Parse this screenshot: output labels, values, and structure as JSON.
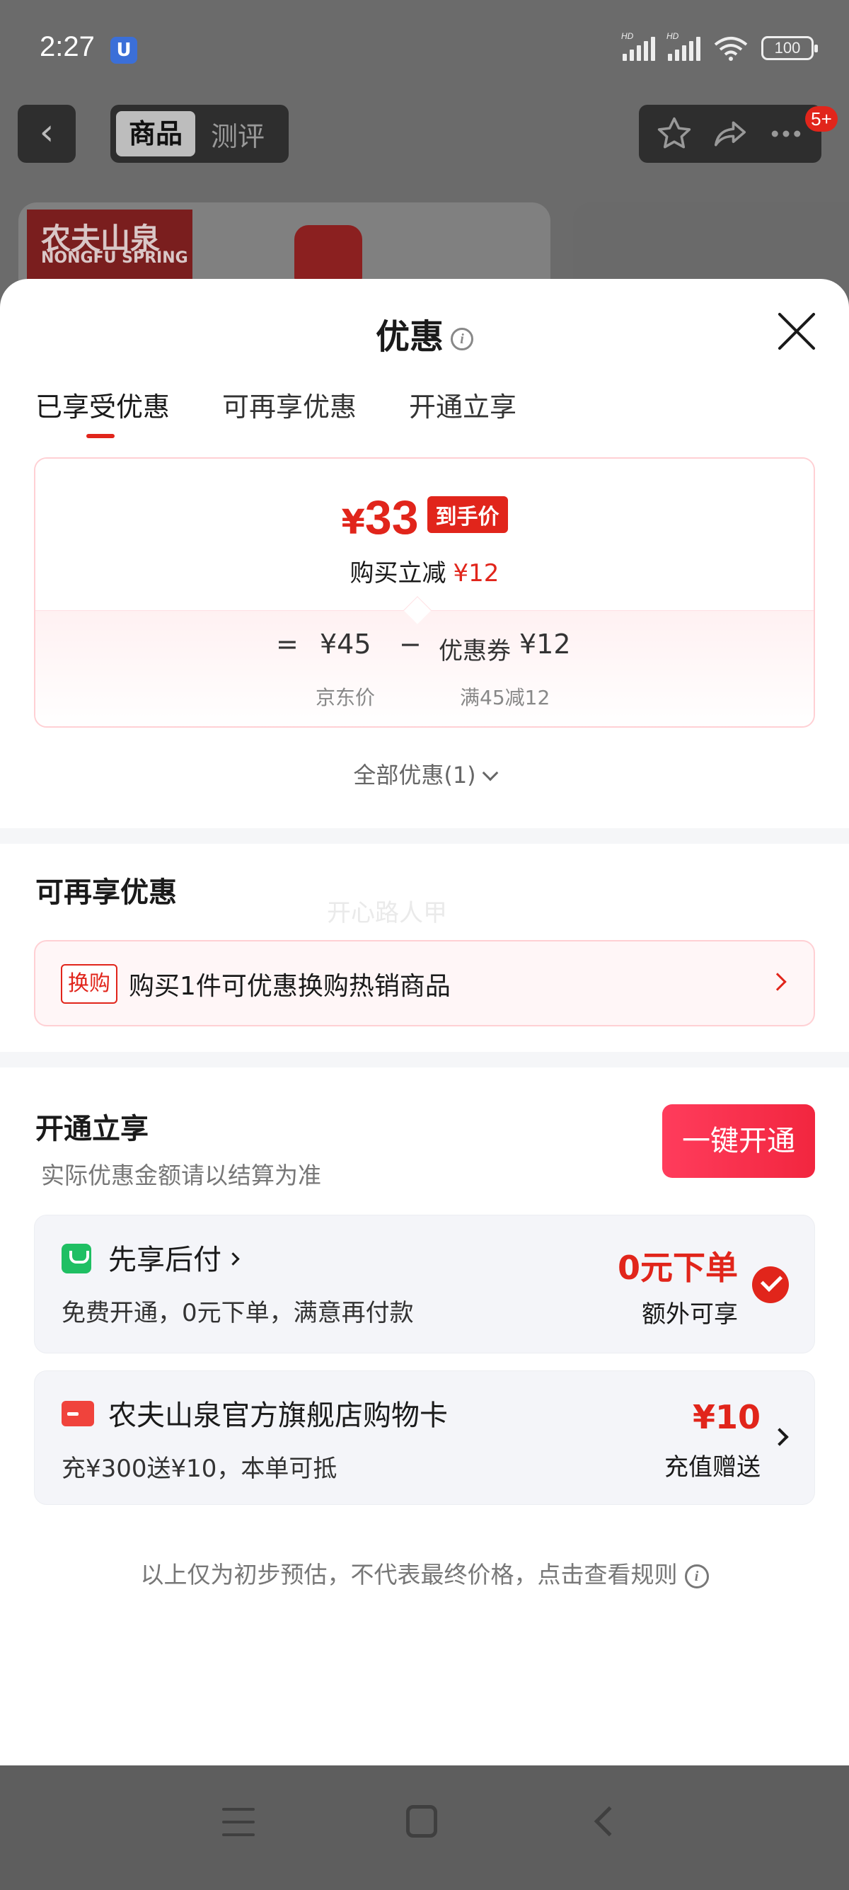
{
  "status_bar": {
    "time": "2:27",
    "app_icon": "U",
    "battery": "100",
    "signal_label": "HD"
  },
  "top_nav": {
    "segment_active": "商品",
    "segment_inactive": "测评",
    "more_badge": "5+"
  },
  "product": {
    "brand_cn": "农夫山泉",
    "brand_en": "NONGFU SPRING"
  },
  "sheet": {
    "title": "优惠",
    "tabs": [
      "已享受优惠",
      "可再享优惠",
      "开通立享"
    ],
    "price": {
      "yen": "¥",
      "amount": "33",
      "tag": "到手价",
      "reduce_label": "购买立减",
      "reduce_value": "¥12",
      "eq": "=",
      "base_price": "¥45",
      "minus": "−",
      "coupon_label": "优惠券",
      "coupon_value": "¥12",
      "base_label": "京东价",
      "coupon_rule": "满45减12"
    },
    "all_discount": "全部优惠(1)",
    "more_section": {
      "title": "可再享优惠",
      "watermark": "开心路人甲",
      "exchange_tag": "换购",
      "exchange_text": "购买1件可优惠换购热销商品"
    },
    "open_section": {
      "title": "开通立享",
      "button": "一键开通",
      "note": "实际优惠金额请以结算为准",
      "card1": {
        "title": "先享后付",
        "desc": "免费开通，0元下单，满意再付款",
        "big_red": "0元下单",
        "sub_right": "额外可享"
      },
      "card2": {
        "title": "农夫山泉官方旗舰店购物卡",
        "desc": "充¥300送¥10，本单可抵",
        "big_red": "¥10",
        "sub_right": "充值赠送"
      }
    },
    "footer_note": "以上仅为初步预估，不代表最终价格，点击查看规则"
  },
  "colors": {
    "accent": "#e1251b",
    "card_bg": "#f4f5f9",
    "divider": "#f5f6f8"
  }
}
